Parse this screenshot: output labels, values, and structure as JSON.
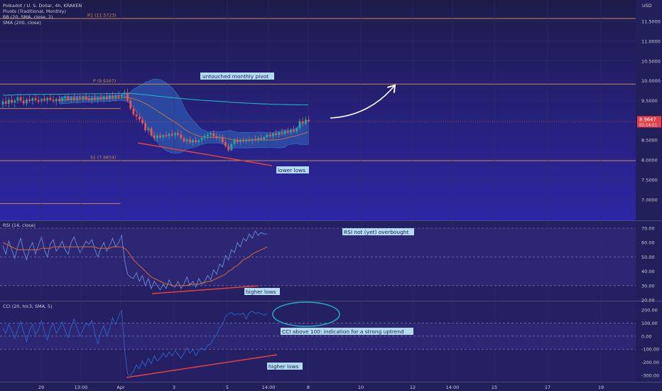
{
  "header": {
    "symbol": "Polkadot / U. S. Dollar, 4h, KRAKEN",
    "indicators": [
      "Pivots (Traditional, Monthly)",
      "BB (20, SMA, close, 2)",
      "SMA (200, close)"
    ],
    "currency": "USD"
  },
  "colors": {
    "background": "#22205a",
    "grid": "#2f2e6b",
    "bb_fill": "#2d4fa8",
    "bb_line": "#3566b8",
    "sma200": "#1fb0c4",
    "basis": "#c0703a",
    "candle_up": "#26a69a",
    "candle_down": "#ef5350",
    "pivot": "#c48a52",
    "rsi_line": "#6a8ad8",
    "rsi_ma": "#d06a33",
    "cci_line": "#2f62c8",
    "trend_red": "#e5413f",
    "circle": "#1fb0c4",
    "price_label": "#e33f4a"
  },
  "chart_data": [
    {
      "type": "candlestick",
      "title": "Polkadot / U. S. Dollar, 4h, KRAKEN",
      "x_ticks": [
        "29",
        "13:00",
        "Apr",
        "3",
        "5",
        "14:00",
        "8",
        "10",
        "12",
        "14:00",
        "15",
        "17",
        "19"
      ],
      "y_ticks": [
        "11.5000",
        "11.0000",
        "10.5000",
        "10.0000",
        "9.5000",
        "9.0000",
        "8.5000",
        "8.0000",
        "7.5000",
        "7.0000"
      ],
      "ylim": [
        6.85,
        11.65
      ],
      "last_price": {
        "value": 8.9647,
        "label": "8.9647",
        "countdown": "02:14:51"
      },
      "pivots": [
        {
          "name": "R1",
          "label": "R1 (11.5723)",
          "value": 11.5723
        },
        {
          "name": "P",
          "label": "P (9.9167)",
          "value": 9.9167
        },
        {
          "name": "S1",
          "label": "S1 (7.9834)",
          "value": 7.9834
        }
      ],
      "previous_month_levels": [
        9.3,
        6.9
      ],
      "annotations": [
        "untouched monthly pivot",
        "lower lows"
      ],
      "candles": [
        {
          "o": 9.4,
          "h": 9.55,
          "l": 9.3,
          "c": 9.48
        },
        {
          "o": 9.48,
          "h": 9.6,
          "l": 9.35,
          "c": 9.42
        },
        {
          "o": 9.42,
          "h": 9.58,
          "l": 9.32,
          "c": 9.52
        },
        {
          "o": 9.52,
          "h": 9.62,
          "l": 9.4,
          "c": 9.45
        },
        {
          "o": 9.45,
          "h": 9.55,
          "l": 9.33,
          "c": 9.5
        },
        {
          "o": 9.5,
          "h": 9.64,
          "l": 9.42,
          "c": 9.58
        },
        {
          "o": 9.58,
          "h": 9.66,
          "l": 9.45,
          "c": 9.5
        },
        {
          "o": 9.5,
          "h": 9.6,
          "l": 9.38,
          "c": 9.43
        },
        {
          "o": 9.43,
          "h": 9.57,
          "l": 9.36,
          "c": 9.53
        },
        {
          "o": 9.53,
          "h": 9.63,
          "l": 9.44,
          "c": 9.49
        },
        {
          "o": 9.49,
          "h": 9.6,
          "l": 9.4,
          "c": 9.56
        },
        {
          "o": 9.56,
          "h": 9.66,
          "l": 9.46,
          "c": 9.51
        },
        {
          "o": 9.51,
          "h": 9.61,
          "l": 9.42,
          "c": 9.47
        },
        {
          "o": 9.47,
          "h": 9.59,
          "l": 9.39,
          "c": 9.55
        },
        {
          "o": 9.55,
          "h": 9.64,
          "l": 9.46,
          "c": 9.5
        },
        {
          "o": 9.5,
          "h": 9.6,
          "l": 9.41,
          "c": 9.57
        },
        {
          "o": 9.57,
          "h": 9.67,
          "l": 9.48,
          "c": 9.52
        },
        {
          "o": 9.52,
          "h": 9.62,
          "l": 9.43,
          "c": 9.48
        },
        {
          "o": 9.48,
          "h": 9.58,
          "l": 9.38,
          "c": 9.54
        },
        {
          "o": 9.54,
          "h": 9.63,
          "l": 9.45,
          "c": 9.49
        },
        {
          "o": 9.49,
          "h": 9.6,
          "l": 9.41,
          "c": 9.56
        },
        {
          "o": 9.56,
          "h": 9.65,
          "l": 9.47,
          "c": 9.6
        },
        {
          "o": 9.6,
          "h": 9.68,
          "l": 9.5,
          "c": 9.53
        },
        {
          "o": 9.53,
          "h": 9.62,
          "l": 9.44,
          "c": 9.58
        },
        {
          "o": 9.58,
          "h": 9.68,
          "l": 9.48,
          "c": 9.54
        },
        {
          "o": 9.54,
          "h": 9.63,
          "l": 9.44,
          "c": 9.59
        },
        {
          "o": 9.59,
          "h": 9.67,
          "l": 9.5,
          "c": 9.55
        },
        {
          "o": 9.55,
          "h": 9.64,
          "l": 9.46,
          "c": 9.6
        },
        {
          "o": 9.6,
          "h": 9.7,
          "l": 9.5,
          "c": 9.55
        },
        {
          "o": 9.55,
          "h": 9.64,
          "l": 9.45,
          "c": 9.51
        },
        {
          "o": 9.51,
          "h": 9.62,
          "l": 9.42,
          "c": 9.57
        },
        {
          "o": 9.57,
          "h": 9.66,
          "l": 9.47,
          "c": 9.52
        },
        {
          "o": 9.52,
          "h": 9.62,
          "l": 9.43,
          "c": 9.58
        },
        {
          "o": 9.58,
          "h": 9.68,
          "l": 9.48,
          "c": 9.54
        },
        {
          "o": 9.54,
          "h": 9.64,
          "l": 9.44,
          "c": 9.6
        },
        {
          "o": 9.6,
          "h": 9.7,
          "l": 9.5,
          "c": 9.56
        },
        {
          "o": 9.56,
          "h": 9.66,
          "l": 9.46,
          "c": 9.62
        },
        {
          "o": 9.62,
          "h": 9.72,
          "l": 9.52,
          "c": 9.58
        },
        {
          "o": 9.58,
          "h": 9.66,
          "l": 9.48,
          "c": 9.63
        },
        {
          "o": 9.63,
          "h": 9.73,
          "l": 9.54,
          "c": 9.6
        },
        {
          "o": 9.6,
          "h": 9.68,
          "l": 9.52,
          "c": 9.66
        },
        {
          "o": 9.66,
          "h": 9.78,
          "l": 9.56,
          "c": 9.7
        },
        {
          "o": 9.7,
          "h": 9.8,
          "l": 9.45,
          "c": 9.5
        },
        {
          "o": 9.5,
          "h": 9.55,
          "l": 9.25,
          "c": 9.3
        },
        {
          "o": 9.3,
          "h": 9.38,
          "l": 9.1,
          "c": 9.15
        },
        {
          "o": 9.15,
          "h": 9.25,
          "l": 9.0,
          "c": 9.1
        },
        {
          "o": 9.1,
          "h": 9.18,
          "l": 8.95,
          "c": 9.02
        },
        {
          "o": 9.02,
          "h": 9.1,
          "l": 8.88,
          "c": 8.93
        },
        {
          "o": 8.93,
          "h": 9.0,
          "l": 8.7,
          "c": 8.75
        },
        {
          "o": 8.75,
          "h": 8.85,
          "l": 8.65,
          "c": 8.8
        },
        {
          "o": 8.8,
          "h": 8.85,
          "l": 8.58,
          "c": 8.62
        },
        {
          "o": 8.62,
          "h": 8.72,
          "l": 8.5,
          "c": 8.55
        },
        {
          "o": 8.55,
          "h": 8.68,
          "l": 8.48,
          "c": 8.62
        },
        {
          "o": 8.62,
          "h": 8.7,
          "l": 8.52,
          "c": 8.57
        },
        {
          "o": 8.57,
          "h": 8.66,
          "l": 8.5,
          "c": 8.63
        },
        {
          "o": 8.63,
          "h": 8.72,
          "l": 8.55,
          "c": 8.6
        },
        {
          "o": 8.6,
          "h": 8.7,
          "l": 8.52,
          "c": 8.66
        },
        {
          "o": 8.66,
          "h": 8.76,
          "l": 8.58,
          "c": 8.62
        },
        {
          "o": 8.62,
          "h": 8.72,
          "l": 8.53,
          "c": 8.68
        },
        {
          "o": 8.68,
          "h": 8.78,
          "l": 8.6,
          "c": 8.64
        },
        {
          "o": 8.64,
          "h": 8.74,
          "l": 8.5,
          "c": 8.55
        },
        {
          "o": 8.55,
          "h": 8.62,
          "l": 8.42,
          "c": 8.47
        },
        {
          "o": 8.47,
          "h": 8.57,
          "l": 8.4,
          "c": 8.52
        },
        {
          "o": 8.52,
          "h": 8.6,
          "l": 8.4,
          "c": 8.44
        },
        {
          "o": 8.44,
          "h": 8.54,
          "l": 8.36,
          "c": 8.5
        },
        {
          "o": 8.5,
          "h": 8.58,
          "l": 8.4,
          "c": 8.45
        },
        {
          "o": 8.45,
          "h": 8.54,
          "l": 8.37,
          "c": 8.5
        },
        {
          "o": 8.5,
          "h": 8.6,
          "l": 8.42,
          "c": 8.56
        },
        {
          "o": 8.56,
          "h": 8.66,
          "l": 8.48,
          "c": 8.6
        },
        {
          "o": 8.6,
          "h": 8.7,
          "l": 8.52,
          "c": 8.64
        },
        {
          "o": 8.64,
          "h": 8.72,
          "l": 8.55,
          "c": 8.68
        },
        {
          "o": 8.68,
          "h": 8.75,
          "l": 8.55,
          "c": 8.6
        },
        {
          "o": 8.6,
          "h": 8.68,
          "l": 8.5,
          "c": 8.55
        },
        {
          "o": 8.55,
          "h": 8.65,
          "l": 8.46,
          "c": 8.58
        },
        {
          "o": 8.58,
          "h": 8.64,
          "l": 8.4,
          "c": 8.45
        },
        {
          "o": 8.45,
          "h": 8.52,
          "l": 8.3,
          "c": 8.35
        },
        {
          "o": 8.35,
          "h": 8.42,
          "l": 8.2,
          "c": 8.25
        },
        {
          "o": 8.25,
          "h": 8.45,
          "l": 8.22,
          "c": 8.4
        },
        {
          "o": 8.4,
          "h": 8.55,
          "l": 8.35,
          "c": 8.5
        },
        {
          "o": 8.5,
          "h": 8.58,
          "l": 8.4,
          "c": 8.45
        },
        {
          "o": 8.45,
          "h": 8.55,
          "l": 8.38,
          "c": 8.5
        },
        {
          "o": 8.5,
          "h": 8.58,
          "l": 8.42,
          "c": 8.47
        },
        {
          "o": 8.47,
          "h": 8.56,
          "l": 8.4,
          "c": 8.52
        },
        {
          "o": 8.52,
          "h": 8.6,
          "l": 8.44,
          "c": 8.48
        },
        {
          "o": 8.48,
          "h": 8.57,
          "l": 8.4,
          "c": 8.53
        },
        {
          "o": 8.53,
          "h": 8.62,
          "l": 8.45,
          "c": 8.5
        },
        {
          "o": 8.5,
          "h": 8.6,
          "l": 8.43,
          "c": 8.56
        },
        {
          "o": 8.56,
          "h": 8.65,
          "l": 8.48,
          "c": 8.52
        },
        {
          "o": 8.52,
          "h": 8.62,
          "l": 8.46,
          "c": 8.58
        },
        {
          "o": 8.58,
          "h": 8.68,
          "l": 8.5,
          "c": 8.64
        },
        {
          "o": 8.64,
          "h": 8.72,
          "l": 8.55,
          "c": 8.6
        },
        {
          "o": 8.6,
          "h": 8.7,
          "l": 8.53,
          "c": 8.67
        },
        {
          "o": 8.67,
          "h": 8.76,
          "l": 8.58,
          "c": 8.63
        },
        {
          "o": 8.63,
          "h": 8.72,
          "l": 8.56,
          "c": 8.7
        },
        {
          "o": 8.7,
          "h": 8.8,
          "l": 8.62,
          "c": 8.66
        },
        {
          "o": 8.66,
          "h": 8.76,
          "l": 8.6,
          "c": 8.73
        },
        {
          "o": 8.73,
          "h": 8.82,
          "l": 8.64,
          "c": 8.69
        },
        {
          "o": 8.69,
          "h": 8.8,
          "l": 8.62,
          "c": 8.76
        },
        {
          "o": 8.76,
          "h": 8.86,
          "l": 8.68,
          "c": 8.72
        },
        {
          "o": 8.72,
          "h": 8.84,
          "l": 8.66,
          "c": 8.8
        },
        {
          "o": 8.8,
          "h": 9.05,
          "l": 8.76,
          "c": 8.98
        },
        {
          "o": 8.98,
          "h": 9.08,
          "l": 8.85,
          "c": 8.92
        },
        {
          "o": 8.92,
          "h": 9.1,
          "l": 8.88,
          "c": 9.02
        },
        {
          "o": 9.02,
          "h": 9.12,
          "l": 8.95,
          "c": 8.9647
        }
      ]
    },
    {
      "type": "line",
      "title": "RSI (14, close)",
      "y_ticks": [
        "70.00",
        "60.00",
        "50.00",
        "40.00",
        "30.00",
        "20.00"
      ],
      "ylim": [
        18,
        73
      ],
      "bands": [
        30,
        50,
        70
      ],
      "series": [
        {
          "name": "RSI",
          "values": [
            58,
            52,
            61,
            55,
            49,
            57,
            63,
            54,
            48,
            56,
            60,
            52,
            58,
            64,
            55,
            50,
            59,
            62,
            54,
            57,
            61,
            55,
            52,
            60,
            64,
            58,
            53,
            57,
            61,
            59,
            62,
            55,
            50,
            56,
            60,
            54,
            58,
            63,
            57,
            60,
            65,
            48,
            38,
            36,
            35,
            39,
            33,
            37,
            30,
            35,
            28,
            33,
            30,
            27,
            31,
            28,
            34,
            30,
            29,
            33,
            28,
            31,
            36,
            30,
            33,
            29,
            35,
            31,
            33,
            37,
            34,
            41,
            38,
            45,
            43,
            51,
            48,
            55,
            53,
            60,
            57,
            63,
            61,
            66,
            63,
            68,
            65,
            67,
            66,
            66
          ]
        },
        {
          "name": "MA",
          "values": [
            60,
            59,
            58,
            57,
            56,
            55,
            55,
            55,
            55,
            55,
            55,
            55,
            55,
            56,
            56,
            56,
            56,
            57,
            57,
            57,
            57,
            57,
            57,
            57,
            57,
            57,
            57,
            57,
            57,
            57,
            57,
            57,
            56,
            56,
            56,
            56,
            56,
            57,
            57,
            57,
            57,
            56,
            54,
            51,
            48,
            46,
            44,
            42,
            40,
            38,
            36,
            35,
            34,
            33,
            32,
            31,
            31,
            30,
            30,
            30,
            30,
            30,
            30,
            31,
            31,
            31,
            31,
            32,
            32,
            33,
            33,
            34,
            35,
            36,
            37,
            38,
            40,
            41,
            43,
            44,
            46,
            48,
            49,
            50,
            52,
            53,
            54,
            55,
            56,
            57
          ]
        }
      ],
      "annotations": [
        "higher lows",
        "RSI not (yet) overbought"
      ]
    },
    {
      "type": "line",
      "title": "CCI (20, hlc3, SMA, 5)",
      "y_ticks": [
        "200.00",
        "100.00",
        "0.00",
        "-100.00",
        "-200.00",
        "-300.00"
      ],
      "ylim": [
        -340,
        240
      ],
      "bands": [
        -100,
        0,
        100
      ],
      "series": [
        {
          "name": "CCI",
          "values": [
            60,
            20,
            90,
            40,
            -20,
            50,
            110,
            30,
            -40,
            40,
            90,
            10,
            50,
            120,
            30,
            -30,
            60,
            100,
            20,
            60,
            110,
            40,
            -10,
            70,
            130,
            60,
            0,
            50,
            100,
            80,
            120,
            20,
            -60,
            30,
            80,
            0,
            60,
            140,
            90,
            150,
            200,
            -100,
            -290,
            -300,
            -270,
            -220,
            -250,
            -190,
            -230,
            -170,
            -210,
            -150,
            -190,
            -170,
            -130,
            -160,
            -120,
            -150,
            -110,
            -140,
            -170,
            -130,
            -90,
            -130,
            -100,
            -150,
            -110,
            -90,
            -110,
            -70,
            -60,
            -20,
            10,
            60,
            90,
            150,
            170,
            180,
            160,
            170,
            165,
            175,
            130,
            180,
            190,
            175,
            180,
            170,
            160,
            175
          ]
        },
        {
          "name": "MA",
          "values": []
        }
      ],
      "annotations": [
        "CCI above 100: indication for a strong uptrend",
        "higher lows"
      ]
    }
  ]
}
